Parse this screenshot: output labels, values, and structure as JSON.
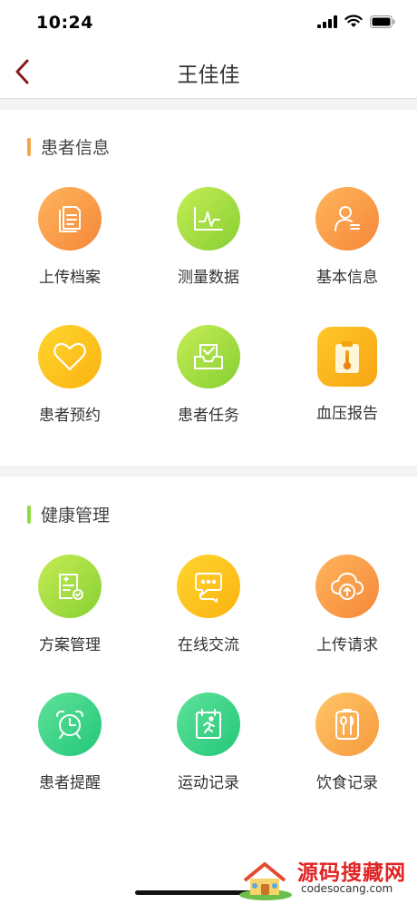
{
  "status_bar": {
    "time": "10:24"
  },
  "nav": {
    "title": "王佳佳",
    "back_icon": "chevron-left-icon"
  },
  "sections": [
    {
      "title": "患者信息",
      "accent": "#f3a54a",
      "items": [
        {
          "label": "上传档案",
          "icon": "document-stack-icon",
          "colors": [
            "#ffb55c",
            "#f5873a"
          ]
        },
        {
          "label": "测量数据",
          "icon": "waveform-chart-icon",
          "colors": [
            "#c6ec55",
            "#86d033"
          ]
        },
        {
          "label": "基本信息",
          "icon": "user-profile-icon",
          "colors": [
            "#ffb55c",
            "#f5873a"
          ]
        },
        {
          "label": "患者预约",
          "icon": "heart-outline-icon",
          "colors": [
            "#ffd630",
            "#fbb20f"
          ]
        },
        {
          "label": "患者任务",
          "icon": "inbox-check-icon",
          "colors": [
            "#c6ec55",
            "#86d033"
          ]
        },
        {
          "label": "血压报告",
          "icon": "thermometer-clipboard-icon",
          "colors": [
            "#ffc82a",
            "#f7a411"
          ]
        }
      ]
    },
    {
      "title": "健康管理",
      "accent": "#8fdc42",
      "items": [
        {
          "label": "方案管理",
          "icon": "plan-document-icon",
          "colors": [
            "#c6ec55",
            "#86d033"
          ]
        },
        {
          "label": "在线交流",
          "icon": "chat-bubbles-icon",
          "colors": [
            "#ffd630",
            "#fbb20f"
          ]
        },
        {
          "label": "上传请求",
          "icon": "cloud-upload-icon",
          "colors": [
            "#ffb55c",
            "#f5873a"
          ]
        },
        {
          "label": "患者提醒",
          "icon": "alarm-clock-icon",
          "colors": [
            "#5fe29a",
            "#22c779"
          ]
        },
        {
          "label": "运动记录",
          "icon": "running-calendar-icon",
          "colors": [
            "#5fe29a",
            "#22c779"
          ]
        },
        {
          "label": "饮食记录",
          "icon": "utensils-icon",
          "colors": [
            "#ffc568",
            "#f59a3c"
          ]
        }
      ]
    }
  ],
  "watermark": {
    "title": "源码搜藏网",
    "url": "codesocang.com"
  }
}
